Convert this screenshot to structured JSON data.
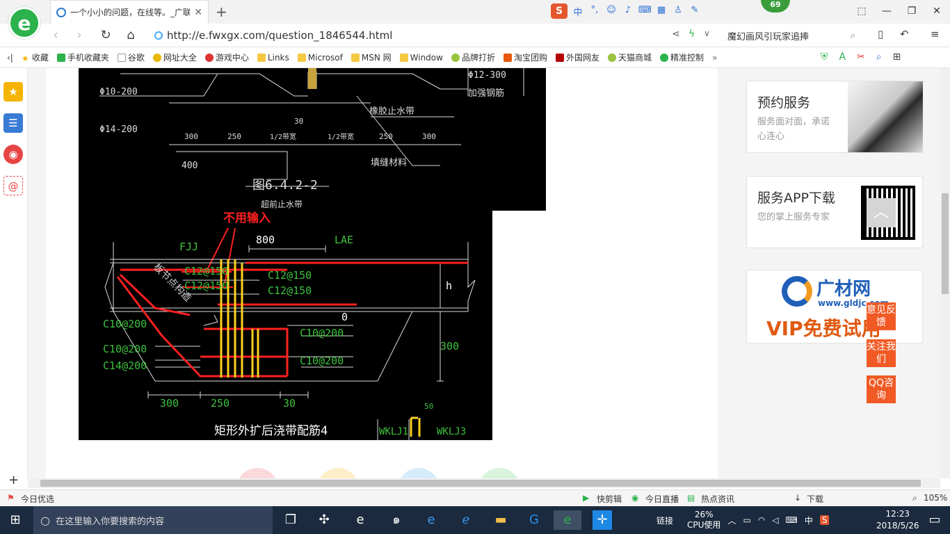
{
  "browser": {
    "tab_title": "一个小小的问题，在线等。_广联",
    "url": "http://e.fwxgx.com/question_1846544.html",
    "search_text": "魔幻画风引玩家追捧",
    "notification_count": "69"
  },
  "bookmarks": [
    "收藏",
    "手机收藏夹",
    "谷歌",
    "网址大全",
    "游戏中心",
    "Links",
    "Microsof",
    "MSN 网",
    "Window",
    "品牌打折",
    "淘宝团购",
    "外国网友",
    "天猫商城",
    "精准控制"
  ],
  "cad": {
    "top_labels": [
      "Φ10-200",
      "Φ14-200",
      "Φ12-300",
      "加强钢筋",
      "橡胶止水带",
      "填缝材料",
      "400",
      "图6.4.2-2",
      "超前止水带",
      "30",
      "300",
      "250",
      "1/2带宽",
      "1/2带宽",
      "250",
      "300"
    ],
    "annotation": "不用输入",
    "dims": [
      "800",
      "LAE",
      "FJJ",
      "h",
      "0",
      "300",
      "300",
      "250",
      "30",
      "50"
    ],
    "rebar_labels": [
      "C12@150",
      "C12@150",
      "C12@150",
      "C12@150",
      "C10@200",
      "C10@200",
      "C14@200",
      "C10@200",
      "C10@200",
      "板节点构造"
    ],
    "caption": "矩形外扩后浇带配筋4",
    "wkl1": "WKLJ1",
    "wkl3": "WKLJ3"
  },
  "right_cards": {
    "booking_title": "预约服务",
    "booking_sub": "服务面对面，承诺心连心",
    "app_title": "服务APP下载",
    "app_sub": "您的掌上服务专家",
    "banner_brand": "广材网",
    "banner_url": "www.gldjc.com",
    "banner_vip": "VIP免费试用"
  },
  "float_buttons": [
    "意见反馈",
    "关注我们",
    "QQ咨询"
  ],
  "statusbar": {
    "left": "今日优选",
    "items": [
      "快剪辑",
      "今日直播",
      "热点资讯",
      "下载"
    ],
    "zoom": "105%"
  },
  "taskbar": {
    "search_placeholder": "在这里输入你要搜索的内容",
    "link": "链接",
    "cpu_pct": "26%",
    "cpu_label": "CPU使用",
    "ime": "中",
    "time": "12:23",
    "date": "2018/5/26"
  },
  "colors": {
    "cad_green": "#3ec23e",
    "cad_red": "#ff2020",
    "cad_yellow": "#ffd21f",
    "accent_orange": "#f15a24",
    "browser_green": "#2bb24c"
  }
}
